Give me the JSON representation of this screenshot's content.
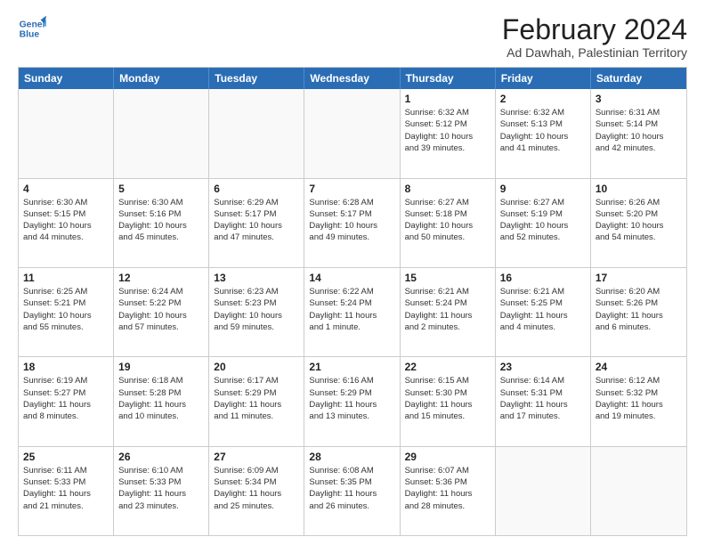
{
  "header": {
    "logo_line1": "General",
    "logo_line2": "Blue",
    "main_title": "February 2024",
    "subtitle": "Ad Dawhah, Palestinian Territory"
  },
  "calendar": {
    "days_of_week": [
      "Sunday",
      "Monday",
      "Tuesday",
      "Wednesday",
      "Thursday",
      "Friday",
      "Saturday"
    ],
    "weeks": [
      [
        {
          "day": "",
          "info": "",
          "empty": true
        },
        {
          "day": "",
          "info": "",
          "empty": true
        },
        {
          "day": "",
          "info": "",
          "empty": true
        },
        {
          "day": "",
          "info": "",
          "empty": true
        },
        {
          "day": "1",
          "info": "Sunrise: 6:32 AM\nSunset: 5:12 PM\nDaylight: 10 hours\nand 39 minutes."
        },
        {
          "day": "2",
          "info": "Sunrise: 6:32 AM\nSunset: 5:13 PM\nDaylight: 10 hours\nand 41 minutes."
        },
        {
          "day": "3",
          "info": "Sunrise: 6:31 AM\nSunset: 5:14 PM\nDaylight: 10 hours\nand 42 minutes."
        }
      ],
      [
        {
          "day": "4",
          "info": "Sunrise: 6:30 AM\nSunset: 5:15 PM\nDaylight: 10 hours\nand 44 minutes."
        },
        {
          "day": "5",
          "info": "Sunrise: 6:30 AM\nSunset: 5:16 PM\nDaylight: 10 hours\nand 45 minutes."
        },
        {
          "day": "6",
          "info": "Sunrise: 6:29 AM\nSunset: 5:17 PM\nDaylight: 10 hours\nand 47 minutes."
        },
        {
          "day": "7",
          "info": "Sunrise: 6:28 AM\nSunset: 5:17 PM\nDaylight: 10 hours\nand 49 minutes."
        },
        {
          "day": "8",
          "info": "Sunrise: 6:27 AM\nSunset: 5:18 PM\nDaylight: 10 hours\nand 50 minutes."
        },
        {
          "day": "9",
          "info": "Sunrise: 6:27 AM\nSunset: 5:19 PM\nDaylight: 10 hours\nand 52 minutes."
        },
        {
          "day": "10",
          "info": "Sunrise: 6:26 AM\nSunset: 5:20 PM\nDaylight: 10 hours\nand 54 minutes."
        }
      ],
      [
        {
          "day": "11",
          "info": "Sunrise: 6:25 AM\nSunset: 5:21 PM\nDaylight: 10 hours\nand 55 minutes."
        },
        {
          "day": "12",
          "info": "Sunrise: 6:24 AM\nSunset: 5:22 PM\nDaylight: 10 hours\nand 57 minutes."
        },
        {
          "day": "13",
          "info": "Sunrise: 6:23 AM\nSunset: 5:23 PM\nDaylight: 10 hours\nand 59 minutes."
        },
        {
          "day": "14",
          "info": "Sunrise: 6:22 AM\nSunset: 5:24 PM\nDaylight: 11 hours\nand 1 minute."
        },
        {
          "day": "15",
          "info": "Sunrise: 6:21 AM\nSunset: 5:24 PM\nDaylight: 11 hours\nand 2 minutes."
        },
        {
          "day": "16",
          "info": "Sunrise: 6:21 AM\nSunset: 5:25 PM\nDaylight: 11 hours\nand 4 minutes."
        },
        {
          "day": "17",
          "info": "Sunrise: 6:20 AM\nSunset: 5:26 PM\nDaylight: 11 hours\nand 6 minutes."
        }
      ],
      [
        {
          "day": "18",
          "info": "Sunrise: 6:19 AM\nSunset: 5:27 PM\nDaylight: 11 hours\nand 8 minutes."
        },
        {
          "day": "19",
          "info": "Sunrise: 6:18 AM\nSunset: 5:28 PM\nDaylight: 11 hours\nand 10 minutes."
        },
        {
          "day": "20",
          "info": "Sunrise: 6:17 AM\nSunset: 5:29 PM\nDaylight: 11 hours\nand 11 minutes."
        },
        {
          "day": "21",
          "info": "Sunrise: 6:16 AM\nSunset: 5:29 PM\nDaylight: 11 hours\nand 13 minutes."
        },
        {
          "day": "22",
          "info": "Sunrise: 6:15 AM\nSunset: 5:30 PM\nDaylight: 11 hours\nand 15 minutes."
        },
        {
          "day": "23",
          "info": "Sunrise: 6:14 AM\nSunset: 5:31 PM\nDaylight: 11 hours\nand 17 minutes."
        },
        {
          "day": "24",
          "info": "Sunrise: 6:12 AM\nSunset: 5:32 PM\nDaylight: 11 hours\nand 19 minutes."
        }
      ],
      [
        {
          "day": "25",
          "info": "Sunrise: 6:11 AM\nSunset: 5:33 PM\nDaylight: 11 hours\nand 21 minutes."
        },
        {
          "day": "26",
          "info": "Sunrise: 6:10 AM\nSunset: 5:33 PM\nDaylight: 11 hours\nand 23 minutes."
        },
        {
          "day": "27",
          "info": "Sunrise: 6:09 AM\nSunset: 5:34 PM\nDaylight: 11 hours\nand 25 minutes."
        },
        {
          "day": "28",
          "info": "Sunrise: 6:08 AM\nSunset: 5:35 PM\nDaylight: 11 hours\nand 26 minutes."
        },
        {
          "day": "29",
          "info": "Sunrise: 6:07 AM\nSunset: 5:36 PM\nDaylight: 11 hours\nand 28 minutes."
        },
        {
          "day": "",
          "info": "",
          "empty": true
        },
        {
          "day": "",
          "info": "",
          "empty": true
        }
      ]
    ]
  }
}
